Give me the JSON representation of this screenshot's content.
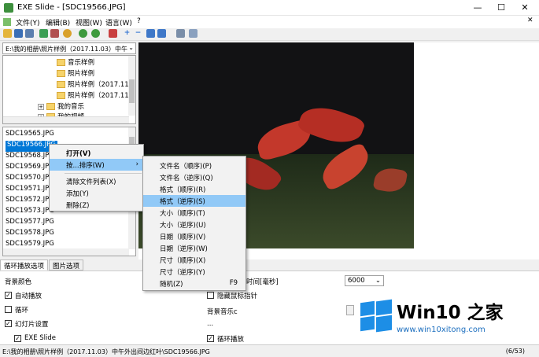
{
  "window": {
    "title": "EXE Slide - [SDC19566.JPG]",
    "controls": {
      "minimize": "—",
      "maximize": "☐",
      "close": "✕",
      "inner_close": "✕"
    }
  },
  "menubar": {
    "items": [
      "文件(Y)",
      "编辑(B)",
      "视图(W)",
      "语言(W)",
      "?"
    ]
  },
  "toolbar": {
    "icons": [
      "folder-open-icon",
      "save-icon",
      "window-icon",
      "image-icon",
      "cut-icon",
      "play-icon",
      "back-icon",
      "forward-icon",
      "delete-icon",
      "add-icon",
      "remove-icon",
      "left-icon",
      "right-icon",
      "grid-icon",
      "screen-icon"
    ]
  },
  "path": {
    "value": "E:\\我的相册\\照片样例（2017.11.03）中午"
  },
  "tree": {
    "items": [
      {
        "label": "音乐样例",
        "type": "folder"
      },
      {
        "label": "照片样例",
        "type": "folder"
      },
      {
        "label": "照片样例（2017.11...",
        "type": "folder"
      },
      {
        "label": "照片样例（2017.11...",
        "type": "folder"
      },
      {
        "label": "我的音乐",
        "type": "expandable"
      },
      {
        "label": "我的视频",
        "type": "expandable"
      }
    ]
  },
  "files": {
    "items": [
      "SDC19565.JPG",
      "SDC19566.JPG",
      "SDC19568.JPG",
      "SDC19569.JPG",
      "SDC19570.JPG",
      "SDC19571.JPG",
      "SDC19572.JPG",
      "SDC19573.JPG",
      "SDC19577.JPG",
      "SDC19578.JPG",
      "SDC19579.JPG"
    ],
    "selected_index": 1
  },
  "context_menu": {
    "items": [
      {
        "label": "打开(V)",
        "bold": true
      },
      {
        "label": "按...排序(W)",
        "submenu": true,
        "highlighted": true
      },
      {
        "label": "清除文件列表(X)"
      },
      {
        "label": "添加(Y)"
      },
      {
        "label": "删除(Z)"
      }
    ],
    "arrow": "›"
  },
  "sort_menu": {
    "items": [
      {
        "label": "文件名（顺序)(P)"
      },
      {
        "label": "文件名（逆序)(Q)"
      },
      {
        "label": "格式（顺序)(R)"
      },
      {
        "label": "格式（逆序)(S)",
        "highlighted": true
      },
      {
        "label": "大小（顺序)(T)"
      },
      {
        "label": "大小（逆序)(U)"
      },
      {
        "label": "日期（顺序)(V)"
      },
      {
        "label": "日期（逆序)(W)"
      },
      {
        "label": "尺寸（顺序)(X)"
      },
      {
        "label": "尺寸（逆序)(Y)"
      },
      {
        "label": "随机(Z)",
        "shortcut": "F9"
      }
    ]
  },
  "tabs": [
    {
      "label": "循环播放选项",
      "active": true
    },
    {
      "label": "图片选项",
      "active": false
    }
  ],
  "settings": {
    "background_color_label": "背景颜色",
    "autoplay": {
      "label": "自动播放",
      "checked": true
    },
    "loop": {
      "label": "循环",
      "checked": false
    },
    "slideshow_settings": {
      "label": "幻灯片设置",
      "checked": true
    },
    "exe_slide": {
      "label": "EXE Slide",
      "checked": true
    },
    "interval_label": "时间[毫秒]",
    "interval_value": "6000",
    "hide_cursor": {
      "label": "隐藏鼠标指针",
      "checked": false
    },
    "bg_music_label": "背景音乐c",
    "ellipsis": "...",
    "loop_play": {
      "label": "循环播放",
      "checked": true
    },
    "check_mark": "✓"
  },
  "statusbar": {
    "path": "E:\\我的相册\\照片样例（2017.11.03）中午外出间边红叶\\SDC19566.JPG",
    "right": "(6/53)"
  },
  "watermark": {
    "brand": "Win10 之家",
    "url": "www.win10xitong.com"
  },
  "colors": {
    "selection": "#0078d7",
    "menu_highlight": "#91c9f7",
    "logo_blue": "#1d8ee6"
  }
}
